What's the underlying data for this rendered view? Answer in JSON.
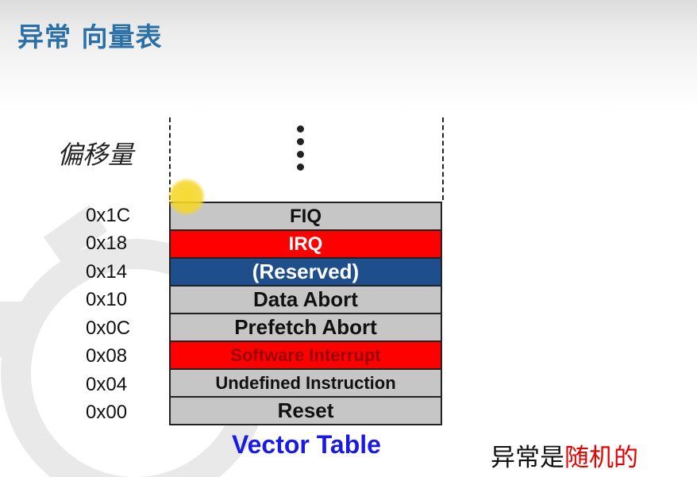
{
  "slide": {
    "title": "异常 向量表",
    "offset_label": "偏移量",
    "caption": "Vector Table",
    "note_prefix": "异常是",
    "note_highlight": "随机的"
  },
  "vector_table": [
    {
      "offset": "0x1C",
      "name": "FIQ",
      "color": "#c6c6c6",
      "text_color": "#111111"
    },
    {
      "offset": "0x18",
      "name": "IRQ",
      "color": "#ff0000",
      "text_color": "#ffffff"
    },
    {
      "offset": "0x14",
      "name": "(Reserved)",
      "color": "#1f4e8c",
      "text_color": "#ffffff"
    },
    {
      "offset": "0x10",
      "name": "Data Abort",
      "color": "#c6c6c6",
      "text_color": "#111111"
    },
    {
      "offset": "0x0C",
      "name": "Prefetch Abort",
      "color": "#c6c6c6",
      "text_color": "#111111"
    },
    {
      "offset": "0x08",
      "name": "Software Interrupt",
      "color": "#ff0000",
      "text_color": "#990000"
    },
    {
      "offset": "0x04",
      "name": "Undefined Instruction",
      "color": "#c6c6c6",
      "text_color": "#111111"
    },
    {
      "offset": "0x00",
      "name": "Reset",
      "color": "#c6c6c6",
      "text_color": "#111111"
    }
  ],
  "colors": {
    "title": "#2a6fa6",
    "caption": "#1a1ae6",
    "note_highlight": "#e60000",
    "cursor": "#f5d728"
  }
}
